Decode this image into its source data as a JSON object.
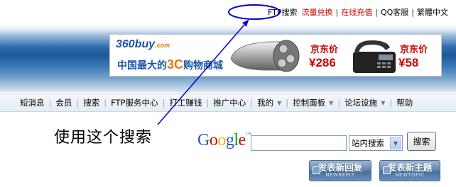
{
  "top_links": [
    {
      "label": "FTP搜索",
      "color": "#000000"
    },
    {
      "label": "流量兑换",
      "color": "#cc0000"
    },
    {
      "label": "在线充值",
      "color": "#cc0000"
    },
    {
      "label": "QQ客服",
      "color": "#000000"
    },
    {
      "label": "繁體中文",
      "color": "#000000"
    }
  ],
  "banner": {
    "brand": "360buy",
    "brand_suffix": ".com",
    "slogan_pre": "中国最大的",
    "slogan_accent": "3C",
    "slogan_post": "购物商城",
    "label_1": "京东价",
    "price_1": "¥286",
    "label_2": "京东价",
    "price_2": "¥58"
  },
  "nav": {
    "items": [
      {
        "label": "短消息",
        "dropdown": false
      },
      {
        "label": "会员",
        "dropdown": false
      },
      {
        "label": "搜索",
        "dropdown": false
      },
      {
        "label": "FTP服务中心",
        "dropdown": false
      },
      {
        "label": "打工赚钱",
        "dropdown": false
      },
      {
        "label": "推广中心",
        "dropdown": false
      },
      {
        "label": "我的",
        "dropdown": true
      },
      {
        "label": "控制面板",
        "dropdown": true
      },
      {
        "label": "论坛设施",
        "dropdown": true
      },
      {
        "label": "帮助",
        "dropdown": false
      }
    ]
  },
  "annotation": {
    "text": "使用这个搜索",
    "color": "#0000cc"
  },
  "search": {
    "engine_letters": [
      "G",
      "o",
      "o",
      "g",
      "l",
      "e"
    ],
    "engine_tm": "™",
    "input_value": "",
    "scope_selected": "站内搜索",
    "button_label": "搜索"
  },
  "post_buttons": {
    "reply_cn": "发表新回复",
    "reply_en": "NEWREPLY",
    "topic_cn": "发表新主题",
    "topic_en": "NEWTOPIC"
  }
}
